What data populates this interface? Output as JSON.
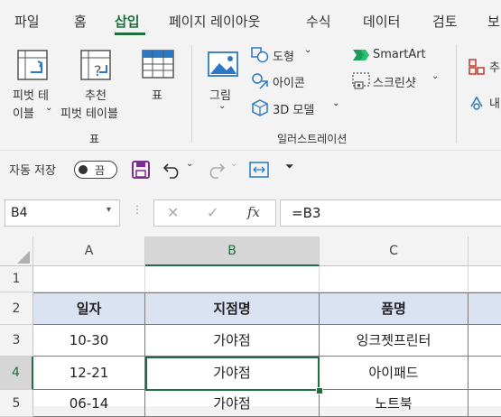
{
  "tabs": [
    "파일",
    "홈",
    "삽입",
    "페이지 레이아웃",
    "수식",
    "데이터",
    "검토",
    "보"
  ],
  "active_tab": "삽입",
  "ribbon": {
    "pivot_table": [
      "피벗 테",
      "이블"
    ],
    "recommended_pivot": [
      "추천",
      "피벗 테이블"
    ],
    "table": "표",
    "group_table": "표",
    "picture": "그림",
    "shapes": "도형",
    "icons": "아이콘",
    "models_3d": "3D 모델",
    "smartart": "SmartArt",
    "screenshot": "스크린샷",
    "group_illustrations": "일러스트레이션",
    "add_partial": "추",
    "my_partial": "내"
  },
  "quick_access": {
    "autosave_label": "자동 저장",
    "autosave_state": "끔"
  },
  "formula_bar": {
    "name_box": "B4",
    "formula": "=B3"
  },
  "grid": {
    "columns": [
      "A",
      "B",
      "C"
    ],
    "selected_column": "B",
    "rows": [
      "1",
      "2",
      "3",
      "4",
      "5"
    ],
    "selected_row": "4",
    "header_row": [
      "일자",
      "지점명",
      "품명"
    ],
    "data_rows": [
      [
        "10-30",
        "가야점",
        "잉크젯프린터"
      ],
      [
        "12-21",
        "가야점",
        "아이패드"
      ],
      [
        "06-14",
        "가야점",
        "노트북"
      ]
    ]
  },
  "colors": {
    "accent": "#1e6e3f",
    "header_fill": "#dbe3f3",
    "background": "#f3f3f3"
  }
}
